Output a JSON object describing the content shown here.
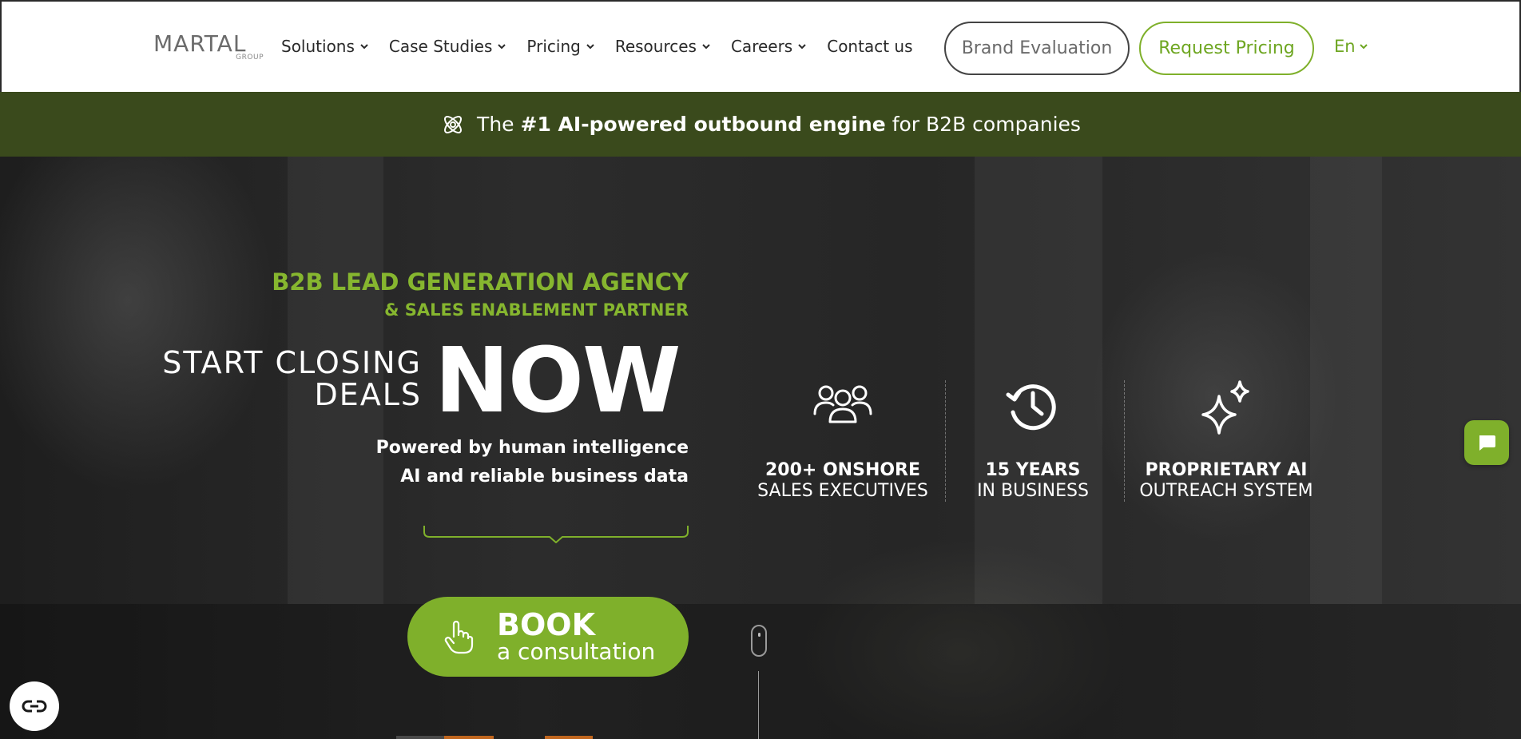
{
  "header": {
    "logo": {
      "main": "MARTAL",
      "sub": "GROUP"
    },
    "nav": [
      {
        "label": "Solutions",
        "has_dropdown": true
      },
      {
        "label": "Case Studies",
        "has_dropdown": true
      },
      {
        "label": "Pricing",
        "has_dropdown": true
      },
      {
        "label": "Resources",
        "has_dropdown": true
      },
      {
        "label": "Careers",
        "has_dropdown": true
      },
      {
        "label": "Contact us",
        "has_dropdown": false
      }
    ],
    "brand_evaluation_label": "Brand Evaluation",
    "request_pricing_label": "Request Pricing",
    "language": "En"
  },
  "announcement": {
    "prefix": "The ",
    "highlight": "#1 AI-powered outbound engine",
    "suffix": " for B2B companies",
    "icon": "atom-icon"
  },
  "hero": {
    "eyebrow_line1": "B2B LEAD GENERATION AGENCY",
    "eyebrow_line2": "& SALES ENABLEMENT PARTNER",
    "headline_line1": "START CLOSING",
    "headline_line2": "DEALS",
    "headline_emphasis": "NOW",
    "subtitle_line1": "Powered by human intelligence",
    "subtitle_line2": "AI and reliable business data",
    "cta_title": "BOOK",
    "cta_subtitle": "a consultation",
    "stats": [
      {
        "line1": "200+ ONSHORE",
        "line2": "SALES EXECUTIVES",
        "icon": "team-icon"
      },
      {
        "line1": "15 YEARS",
        "line2": "IN BUSINESS",
        "icon": "history-clock-icon"
      },
      {
        "line1": "PROPRIETARY AI",
        "line2": "OUTREACH SYSTEM",
        "icon": "sparkle-icon"
      }
    ]
  },
  "colors": {
    "accent_green": "#7fb02b",
    "announcement_bg": "#3a4a1c",
    "hero_bg": "#262626",
    "text_dark": "#2a2a2a"
  }
}
